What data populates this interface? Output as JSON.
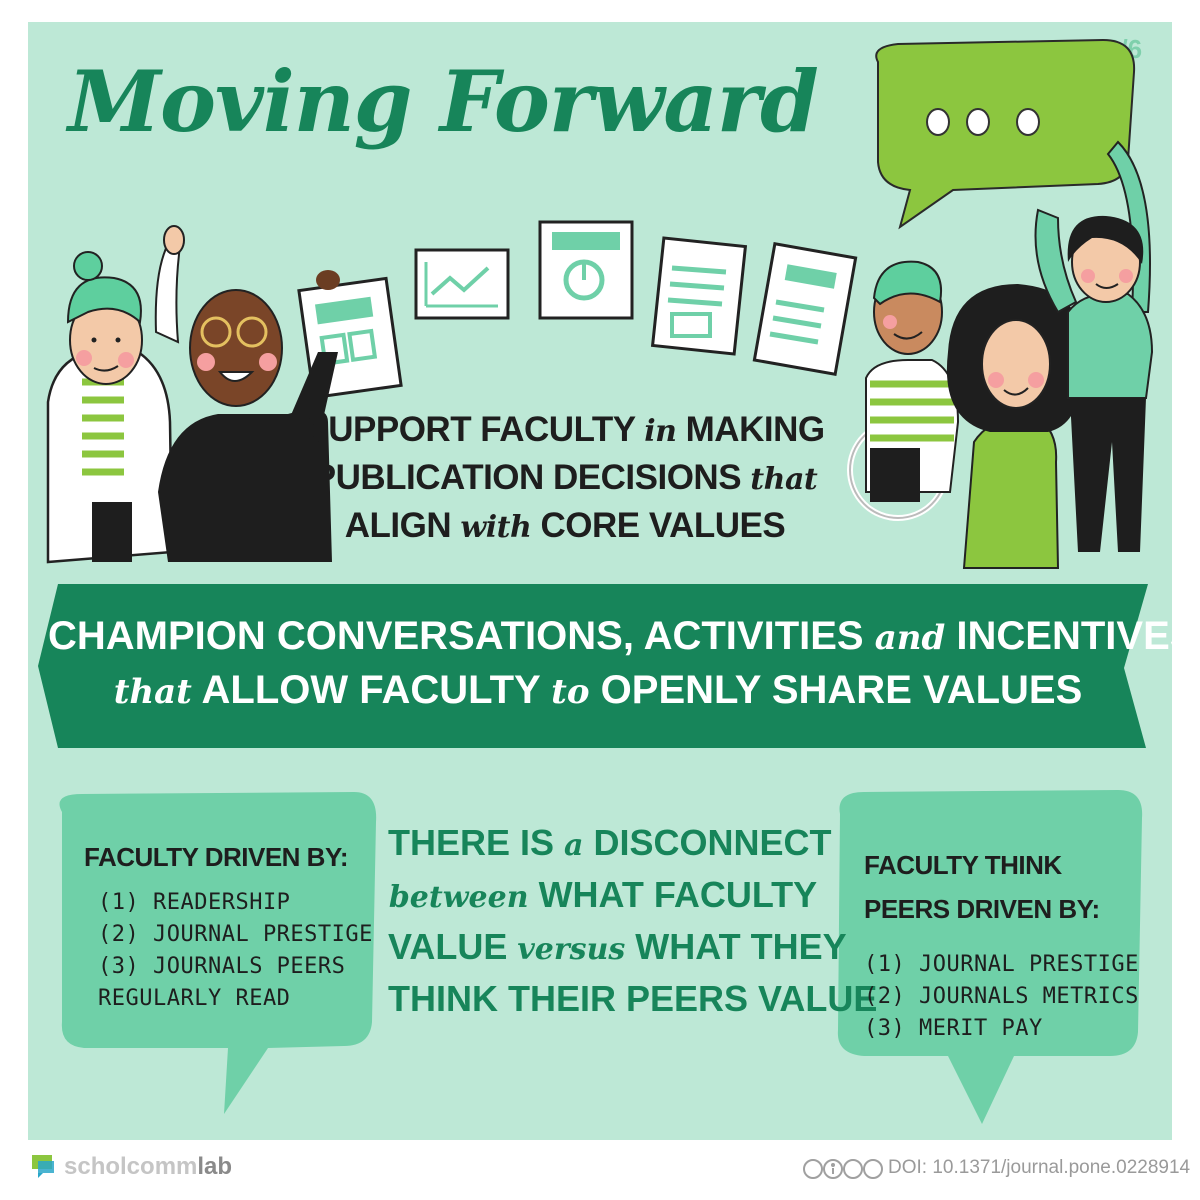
{
  "page_number": "6/6",
  "title": "Moving Forward",
  "speech_bubble": {
    "dots": "..."
  },
  "support": {
    "line1_a": "SUPPORT FACULTY",
    "line1_b": "in",
    "line1_c": "MAKING",
    "line2_a": "PUBLICATION DECISIONS",
    "line2_b": "that",
    "line3_a": "ALIGN",
    "line3_b": "with",
    "line3_c": "CORE VALUES"
  },
  "banner": {
    "line1_a": "CHAMPION CONVERSATIONS, ACTIVITIES",
    "line1_b": "and",
    "line1_c": "INCENTIVES",
    "line2_a": "that",
    "line2_b": "ALLOW FACULTY",
    "line2_c": "to",
    "line2_d": "OPENLY SHARE VALUES"
  },
  "left_bubble": {
    "heading": "FACULTY DRIVEN BY:",
    "items": [
      "(1) READERSHIP",
      "(2) JOURNAL PRESTIGE",
      "(3) JOURNALS PEERS",
      "REGULARLY READ"
    ]
  },
  "disconnect": {
    "line1_a": "THERE IS",
    "line1_b": "a",
    "line1_c": "DISCONNECT",
    "line2_a": "between",
    "line2_b": "WHAT FACULTY",
    "line3_a": "VALUE",
    "line3_b": "versus",
    "line3_c": "WHAT THEY",
    "line4": "THINK THEIR PEERS VALUE"
  },
  "right_bubble": {
    "heading1": "FACULTY THINK",
    "heading2": "PEERS DRIVEN BY:",
    "items": [
      "(1) JOURNAL PRESTIGE",
      "(2) JOURNALS METRICS",
      "(3) MERIT PAY"
    ]
  },
  "footer": {
    "logo_a": "scholcomm",
    "logo_b": "lab",
    "license_badges": "cc by nc sa",
    "doi": "DOI: 10.1371/journal.pone.0228914"
  },
  "colors": {
    "background": "#bde8d6",
    "dark_green": "#17855a",
    "mid_green": "#6fd0a8",
    "lime": "#8cc63f",
    "text_dark": "#1e1e1e"
  }
}
